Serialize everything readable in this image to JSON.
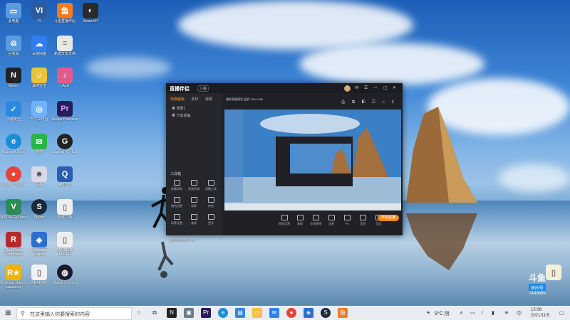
{
  "desktop_icons": [
    {
      "label": "此电脑",
      "icon": "computer-icon",
      "color": "#5a9be0"
    },
    {
      "label": "VI",
      "icon": "vi-icon",
      "color": "#2c5a9c"
    },
    {
      "label": "斗鱼直播伴侣",
      "icon": "douyu-icon",
      "color": "#f07c22"
    },
    {
      "label": "SteamVR",
      "icon": "steamvr-icon",
      "color": "#2a2a2a"
    },
    {
      "label": "回收站",
      "icon": "recycle-bin-icon",
      "color": "#5a9be0"
    },
    {
      "label": "百度网盘",
      "icon": "baidu-netdisk-icon",
      "color": "#2f7ff0"
    },
    {
      "label": "新建文本文档",
      "icon": "text-file-icon",
      "color": "#e8e8e8"
    },
    {
      "label": "Notion",
      "icon": "notion-icon",
      "color": "#222"
    },
    {
      "label": "海绵宝宝",
      "icon": "game-icon",
      "color": "#e9c339"
    },
    {
      "label": "LALA",
      "icon": "lala-icon",
      "color": "#e25a8e"
    },
    {
      "label": "火绒安全",
      "icon": "shield-icon",
      "color": "#2a8ae0"
    },
    {
      "label": "千牛工作台",
      "icon": "qianniu-icon",
      "color": "#6fb3ff"
    },
    {
      "label": "Adobe Premiere P...",
      "icon": "premiere-icon",
      "color": "#2a1b5b"
    },
    {
      "label": "Microsoft Edge",
      "icon": "edge-icon",
      "color": "#1a8fd9"
    },
    {
      "label": "微信",
      "icon": "wechat-icon",
      "color": "#2ab34a"
    },
    {
      "label": "Logitech G HUB",
      "icon": "logitech-icon",
      "color": "#222"
    },
    {
      "label": "Google Chrome",
      "icon": "chrome-icon",
      "color": "#e54335"
    },
    {
      "label": "网易",
      "icon": "anime-icon",
      "color": "#d8d8e8"
    },
    {
      "label": "腾讯QQ",
      "icon": "qq-icon",
      "color": "#2a5fb0"
    },
    {
      "label": "NVIDIA GeForce",
      "icon": "nvidia-icon",
      "color": "#2e8b57"
    },
    {
      "label": "Steam",
      "icon": "steam-icon",
      "color": "#1b2838"
    },
    {
      "label": "新建文档",
      "icon": "document-icon",
      "color": "#eeeeee"
    },
    {
      "label": "Red Dead Redemption",
      "icon": "rdr-icon",
      "color": "#b52b2b"
    },
    {
      "label": "Wallpaper Engine",
      "icon": "wallpaper-icon",
      "color": "#2b6fd0"
    },
    {
      "label": "DEVELOP ALONE",
      "icon": "file-icon",
      "color": "#eeeeee"
    },
    {
      "label": "Rockstar Games Launcher",
      "icon": "rockstar-icon",
      "color": "#f0b400"
    },
    {
      "label": "README",
      "icon": "doc-icon",
      "color": "#f2f2f2"
    },
    {
      "label": "Ubisoft Connect",
      "icon": "ubisoft-icon",
      "color": "#1a1a2e"
    }
  ],
  "app": {
    "brand": "直播伴侣",
    "badge": "斗鱼",
    "window_controls": "⚙ ✉ ☰ — ▢ ✕",
    "tabs": [
      "场景面板",
      "素材",
      "弹幕"
    ],
    "scenes": [
      "场景1",
      "分享桌面"
    ],
    "preview_header": "横屏直播预览 竖屏 720×1280",
    "preview_icons": "⎙ ⧉ ◧ ◫ ⌂ ⇪",
    "tools_title": "工具箱",
    "tools": [
      "屏幕录制",
      "视频剪辑",
      "直播工具",
      "相机设置",
      "录屏",
      "特效",
      "场景设置",
      "美颜",
      "更多"
    ],
    "bottom_tools": [
      "画面设置",
      "美颜",
      "全网直播",
      "连麦",
      "PK",
      "音效",
      "互动"
    ],
    "live_button": "开始直播",
    "status_text": "当前直播分辨率720P"
  },
  "taskbar": {
    "search_placeholder": "在这里输入你要搜索的内容",
    "weather": "9°C 阴",
    "time": "15:08",
    "date": "2021/11/5",
    "lang": "中"
  },
  "watermark": {
    "logo": "斗鱼",
    "room_label": "房间号",
    "room_no": "7430895"
  }
}
